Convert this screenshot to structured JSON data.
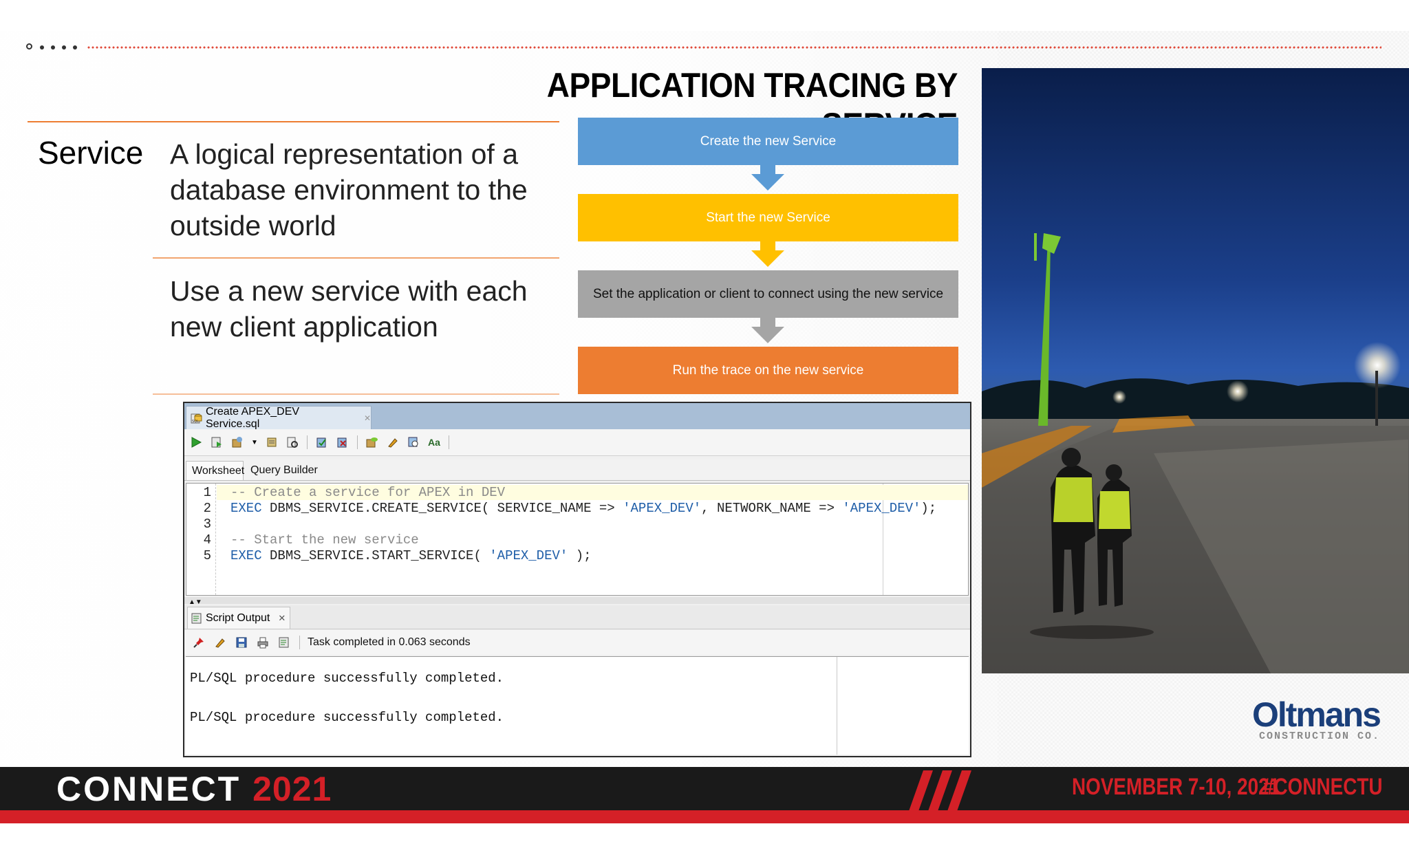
{
  "slide": {
    "title": "APPLICATION TRACING BY SERVICE",
    "term": "Service",
    "definition": "A logical representation of a database environment to the outside world",
    "usage": "Use a new service with each new client application"
  },
  "flow": {
    "steps": [
      {
        "label": "Create the new Service",
        "color": "#5b9bd5",
        "text_color": "#ffffff"
      },
      {
        "label": "Start the new Service",
        "color": "#ffc000",
        "text_color": "#ffffff"
      },
      {
        "label": "Set the application or client to connect using the new service",
        "color": "#a5a5a5",
        "text_color": "#111111"
      },
      {
        "label": "Run the trace on the new service",
        "color": "#ed7d31",
        "text_color": "#ffffff"
      }
    ]
  },
  "ide": {
    "file_tab": "Create APEX_DEV Service.sql",
    "subtabs": [
      "Worksheet",
      "Query Builder"
    ],
    "line_numbers": [
      "1",
      "2",
      "3",
      "4",
      "5"
    ],
    "code": {
      "l1_comment": "-- Create a service for APEX in DEV",
      "l2_kw": "EXEC",
      "l2_a": " DBMS_SERVICE.CREATE_SERVICE( SERVICE_NAME => ",
      "l2_s1": "'APEX_DEV'",
      "l2_b": ", NETWORK_NAME => ",
      "l2_s2": "'APEX_DEV'",
      "l2_c": ");",
      "l4_comment": "-- Start the new service",
      "l5_kw": "EXEC",
      "l5_a": " DBMS_SERVICE.START_SERVICE( ",
      "l5_s1": "'APEX_DEV'",
      "l5_c": " );"
    },
    "output_tab": "Script Output",
    "status": "Task completed in 0.063 seconds",
    "output_lines": [
      "PL/SQL procedure successfully completed.",
      "PL/SQL procedure successfully completed."
    ]
  },
  "logo": {
    "main": "Oltmans",
    "sub": "CONSTRUCTION CO."
  },
  "footer": {
    "brand": "CONNECT",
    "year": "2021",
    "dates": "NOVEMBER 7-10, 2021",
    "hashtag": "#CONNECTU"
  },
  "colors": {
    "accent": "#ed7d31",
    "footer_red": "#d42027",
    "keyword": "#1f5ea8"
  }
}
